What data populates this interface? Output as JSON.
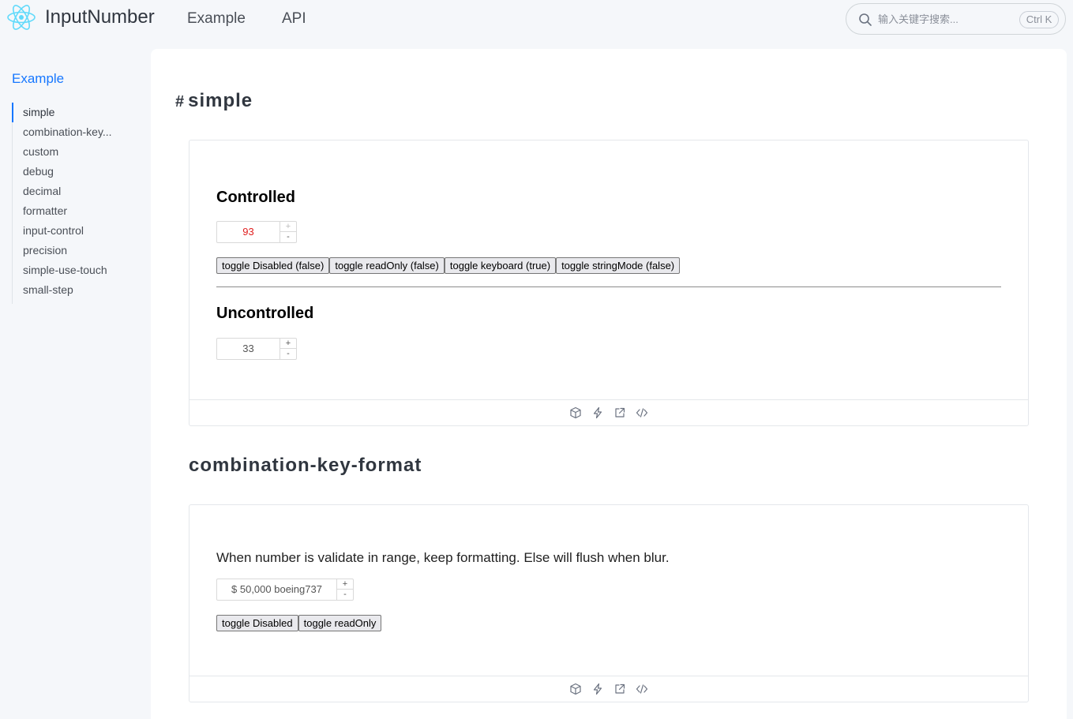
{
  "header": {
    "app_title": "InputNumber",
    "nav": [
      "Example",
      "API"
    ],
    "search_placeholder": "输入关键字搜索...",
    "shortcut": "Ctrl K"
  },
  "sidebar": {
    "title": "Example",
    "items": [
      "simple",
      "combination-key...",
      "custom",
      "debug",
      "decimal",
      "formatter",
      "input-control",
      "precision",
      "simple-use-touch",
      "small-step"
    ],
    "active_index": 0
  },
  "sections": {
    "simple": {
      "hash": "#",
      "title": "simple",
      "controlled_heading": "Controlled",
      "controlled_value": "93",
      "controlled_up": "+",
      "controlled_down": "-",
      "buttons": [
        "toggle Disabled (false)",
        "toggle readOnly (false)",
        "toggle keyboard (true)",
        "toggle stringMode (false)"
      ],
      "uncontrolled_heading": "Uncontrolled",
      "uncontrolled_value": "33",
      "uncontrolled_up": "+",
      "uncontrolled_down": "-"
    },
    "combination": {
      "title": "combination-key-format",
      "description": "When number is validate in range, keep formatting. Else will flush when blur.",
      "value": "$ 50,000 boeing737",
      "up": "+",
      "down": "-",
      "buttons": [
        "toggle Disabled",
        "toggle readOnly"
      ]
    }
  },
  "footer_icons": [
    "codesandbox-icon",
    "stackblitz-icon",
    "open-external-icon",
    "code-icon"
  ],
  "colors": {
    "accent": "#1677ff",
    "controlled_value": "#e01e1e"
  }
}
